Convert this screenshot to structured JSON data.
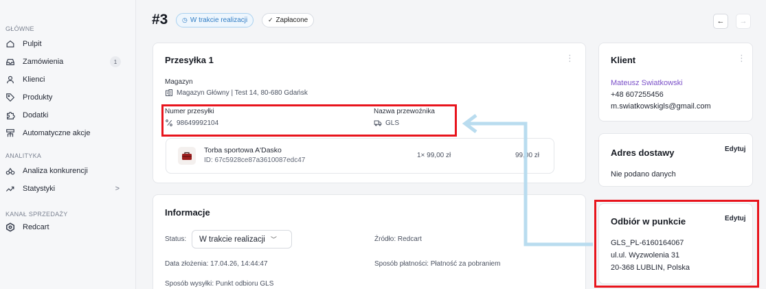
{
  "sidebar": {
    "sections": [
      {
        "label": "GŁÓWNE"
      },
      {
        "label": "ANALITYKA"
      },
      {
        "label": "KANAŁ SPRZEDAŻY"
      }
    ],
    "items": [
      {
        "label": "Pulpit",
        "icon": "home-icon"
      },
      {
        "label": "Zamówienia",
        "icon": "inbox-icon",
        "count": "1"
      },
      {
        "label": "Klienci",
        "icon": "user-icon"
      },
      {
        "label": "Produkty",
        "icon": "tag-icon"
      },
      {
        "label": "Dodatki",
        "icon": "puzzle-icon"
      },
      {
        "label": "Automatyczne akcje",
        "icon": "automation-icon"
      },
      {
        "label": "Analiza konkurencji",
        "icon": "compare-icon"
      },
      {
        "label": "Statystyki",
        "icon": "trend-icon",
        "chevron": ">"
      },
      {
        "label": "Redcart",
        "icon": "redcart-logo-icon"
      }
    ]
  },
  "header": {
    "order_number": "#3",
    "status_pill": "W trakcie realizacji",
    "paid_pill": "Zapłacone",
    "prev": "←",
    "next": "→"
  },
  "shipment": {
    "title": "Przesyłka 1",
    "warehouse_label": "Magazyn",
    "warehouse_value": "Magazyn Główny | Test 14, 80-680 Gdańsk",
    "tracking_label": "Numer przesyłki",
    "tracking_value": "98649992104",
    "carrier_label": "Nazwa przewoźnika",
    "carrier_value": "GLS",
    "product": {
      "name": "Torba sportowa A'Dasko",
      "id": "ID: 67c5928ce87a3610087edc47",
      "qty_price": "1× 99,00 zł",
      "total": "99,00 zł"
    }
  },
  "info": {
    "title": "Informacje",
    "status_label": "Status:",
    "status_value": "W trakcie realizacji",
    "source": "Źródło: Redcart",
    "created": "Data złożenia: 17.04.26, 14:44:47",
    "payment": "Sposób płatności: Płatność za pobraniem",
    "shipping": "Sposób wysyłki: Punkt odbioru GLS"
  },
  "client": {
    "title": "Klient",
    "name": "Mateusz Swiatkowski",
    "phone": "+48 607255456",
    "email": "m.swiatkowskigls@gmail.com"
  },
  "address": {
    "title": "Adres dostawy",
    "edit": "Edytuj",
    "value": "Nie podano danych"
  },
  "pickup": {
    "title": "Odbiór w punkcie",
    "edit": "Edytuj",
    "line1": "GLS_PL-6160164067",
    "line2": "ul.ul. Wyzwolenia 31",
    "line3": "20-368 LUBLIN, Polska"
  },
  "colors": {
    "highlight": "#e8141c",
    "arrow": "#b9dcef",
    "accent": "#7a4fc8",
    "status_blue": "#2f7cc4"
  }
}
